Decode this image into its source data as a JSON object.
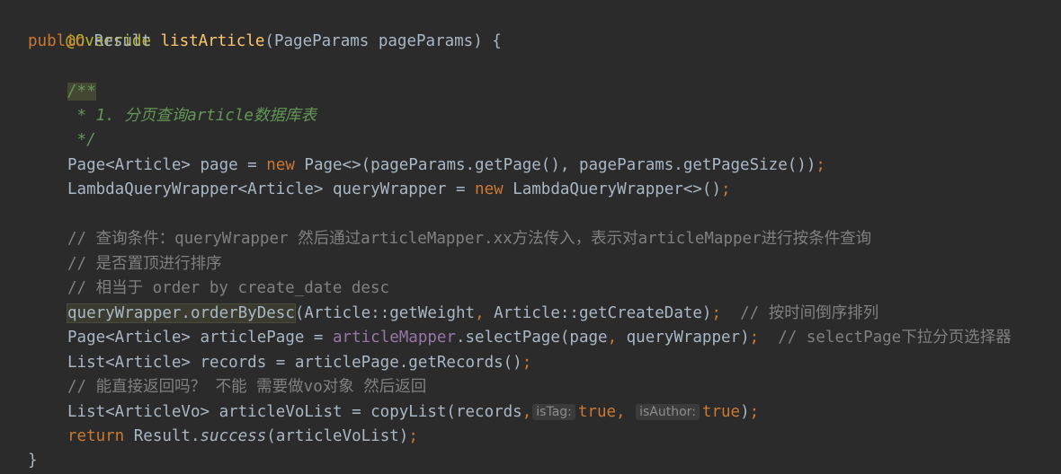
{
  "code": {
    "annotation": "@Override",
    "signature": {
      "modifier": "public",
      "return_type": " Result ",
      "method": "listArticle",
      "params": "(PageParams pageParams) {"
    },
    "doc": {
      "open": "/**",
      "line": " * 1. 分页查询article数据库表",
      "close": " */"
    },
    "page_line": {
      "a": "Page<Article> page = ",
      "kw": "new",
      "b": " Page<>(pageParams.getPage(), pageParams.getPageSize())",
      "semi": ";"
    },
    "wrapper_line": {
      "a": "LambdaQueryWrapper<Article> queryWrapper = ",
      "kw": "new",
      "b": " LambdaQueryWrapper<>()",
      "semi": ";"
    },
    "comment1": "// 查询条件：queryWrapper 然后通过articleMapper.xx方法传入，表示对articleMapper进行按条件查询",
    "comment2": "// 是否置顶进行排序",
    "comment3": "// 相当于 order by create_date desc",
    "order_line": {
      "hl": "queryWrapper.orderByDesc",
      "a": "(Article::getWeight",
      "comma": ",",
      "b": " Article::getCreateDate)",
      "semi": ";",
      "comment": "  // 按时间倒序排列"
    },
    "articlepage_line": {
      "a": "Page<Article> articlePage = ",
      "field": "articleMapper",
      "b": ".selectPage(page",
      "comma": ",",
      "c": " queryWrapper)",
      "semi": ";",
      "comment": "  // selectPage下拉分页选择器"
    },
    "records_line": {
      "a": "List<Article> records = articlePage.getRecords()",
      "semi": ";"
    },
    "comment4": "// 能直接返回吗？ 不能 需要做vo对象 然后返回",
    "volist_line": {
      "a": "List<ArticleVo> articleVoList = copyList(records",
      "comma1": ",",
      "hint1": "isTag:",
      "true1": "true",
      "comma2": ", ",
      "hint2": "isAuthor:",
      "true2": "true",
      "end": ")",
      "semi": ";"
    },
    "return_line": {
      "kw": "return",
      "a": " Result.",
      "call": "success",
      "b": "(articleVoList)",
      "semi": ";"
    },
    "close_brace": "}"
  }
}
